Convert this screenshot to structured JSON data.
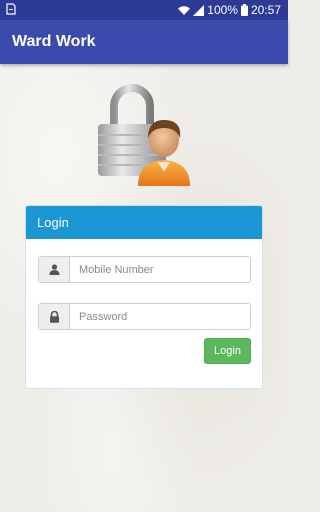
{
  "status_bar": {
    "battery": "100%",
    "time": "20:57",
    "icons": [
      "notification-icon",
      "wifi-icon",
      "signal-icon",
      "battery-icon"
    ]
  },
  "app_bar": {
    "title": "Ward Work"
  },
  "hero": {
    "icon": "lock-user-icon"
  },
  "login_card": {
    "title": "Login",
    "mobile": {
      "icon": "user-icon",
      "placeholder": "Mobile Number",
      "value": ""
    },
    "password": {
      "icon": "lock-icon",
      "placeholder": "Password",
      "value": ""
    },
    "button_label": "Login"
  },
  "colors": {
    "status_bar": "#2d3a96",
    "app_bar": "#3b4aad",
    "card_header": "#1a96d4",
    "button": "#5cb85c",
    "background": "#efede8"
  }
}
